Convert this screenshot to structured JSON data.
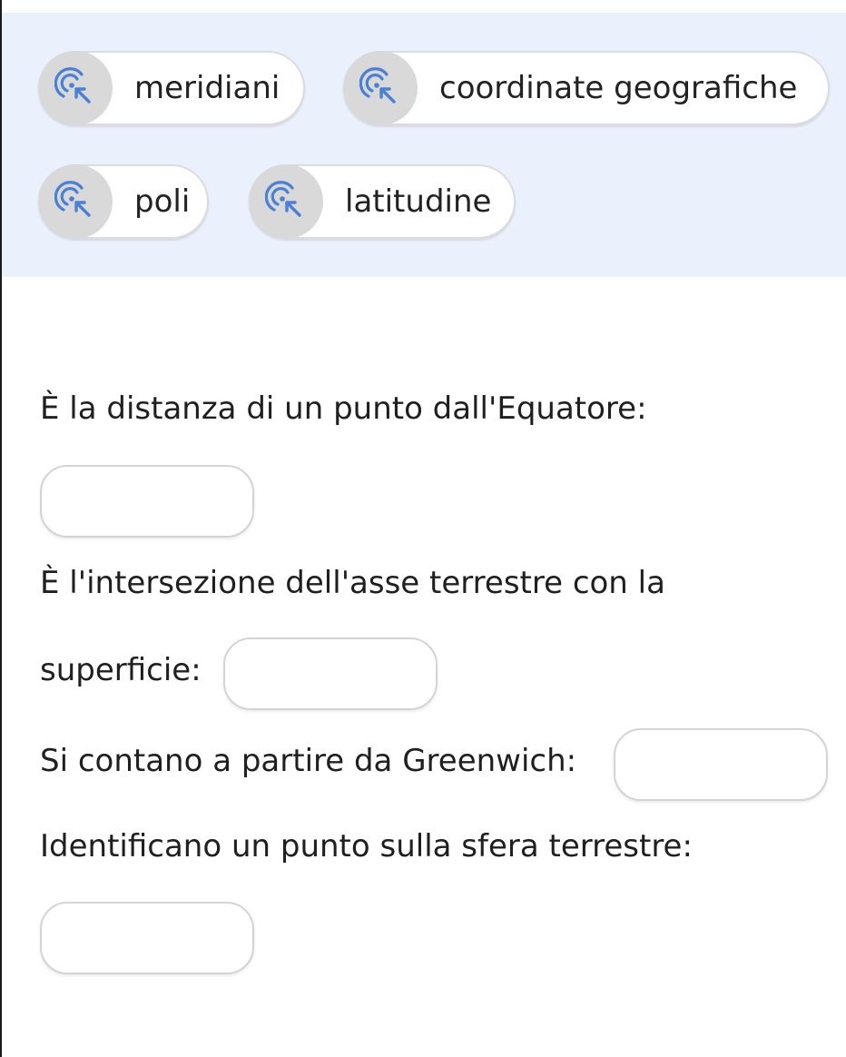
{
  "word_bank": {
    "chips": [
      {
        "label": "meridiani",
        "icon": "drag-target-icon"
      },
      {
        "label": "coordinate geografiche",
        "icon": "drag-target-icon"
      },
      {
        "label": "poli",
        "icon": "drag-target-icon"
      },
      {
        "label": "latitudine",
        "icon": "drag-target-icon"
      }
    ],
    "background_color": "#eaf1fd",
    "handle_color": "#d9d9d9",
    "icon_color": "#4a80d6"
  },
  "questions": [
    {
      "text": "È la distanza di un punto dall'Equatore:"
    },
    {
      "text_line1": "È l'intersezione dell'asse terrestre con la",
      "text_line2": "superficie:"
    },
    {
      "text": "Si contano a partire da Greenwich:"
    },
    {
      "text": "Identificano un punto sulla sfera terrestre:"
    }
  ]
}
